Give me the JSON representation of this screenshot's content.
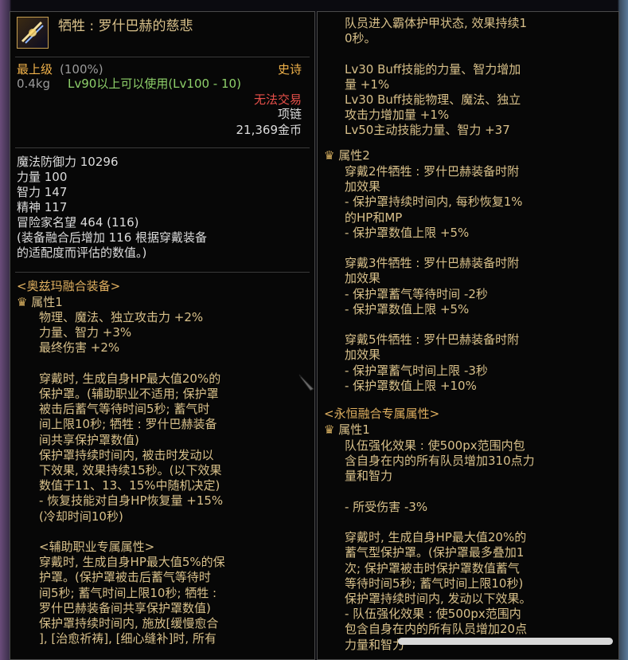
{
  "left": {
    "title": "牺牲 : 罗什巴赫的慈悲",
    "grade": "最上级",
    "grade_pct": "(100%)",
    "rarity": "史诗",
    "weight": "0.4kg",
    "level_req": "Lv90以上可以使用(Lv100 - 10)",
    "trade": "无法交易",
    "slot": "项链",
    "price": "21,369金币",
    "stats": [
      "魔法防御力 10296",
      "力量 100",
      "智力 147",
      "精神 117",
      "冒险家名望 464 (116)",
      "(装备融合后增加 116 根据穿戴装备",
      "的适配度而评估的数值。)"
    ],
    "fusion_header": "<奥兹玛融合装备>",
    "attr1_label": "属性1",
    "attr1_lines": [
      "物理、魔法、独立攻击力 +2%",
      "力量、智力 +3%",
      "最终伤害 +2%",
      "",
      "穿戴时, 生成自身HP最大值20%的",
      "保护罩。(辅助职业不适用; 保护罩",
      "被击后蓄气等待时间5秒; 蓄气时",
      "间上限10秒; 牺牲 : 罗什巴赫装备",
      "间共享保护罩数值)",
      "保护罩持续时间内, 被击时发动以",
      "下效果, 效果持续15秒。(以下效果",
      "数值于11、13、15%中随机决定)",
      "- 恢复技能对自身HP恢复量 +15%",
      "(冷却时间10秒)",
      "",
      "<辅助职业专属属性>",
      "穿戴时, 生成自身HP最大值5%的保",
      "护罩。(保护罩被击后蓄气等待时",
      "间5秒; 蓄气时间上限10秒; 牺牲 :",
      "罗什巴赫装备间共享保护罩数值)",
      "保护罩持续时间内, 施放[缓慢愈合",
      "], [治愈祈祷], [细心缝补]时, 所有"
    ]
  },
  "right": {
    "top_lines": [
      "队员进入霸体护甲状态, 效果持续1",
      "0秒。",
      "",
      "Lv30 Buff技能的力量、智力增加",
      "量 +1%",
      "Lv30 Buff技能物理、魔法、独立",
      "攻击力增加量 +1%",
      "Lv50主动技能力量、智力 +37"
    ],
    "attr2_label": "属性2",
    "attr2_lines": [
      "穿戴2件牺牲 : 罗什巴赫装备时附",
      "加效果",
      "- 保护罩持续时间内, 每秒恢复1%",
      "的HP和MP",
      "- 保护罩数值上限 +5%",
      "",
      "穿戴3件牺牲 : 罗什巴赫装备时附",
      "加效果",
      "- 保护罩蓄气等待时间 -2秒",
      "- 保护罩数值上限 +5%",
      "",
      "穿戴5件牺牲 : 罗什巴赫装备时附",
      "加效果",
      "- 保护罩蓄气时间上限 -3秒",
      "- 保护罩数值上限 +10%"
    ],
    "eternal_header": "<永恒融合专属属性>",
    "eattr1_label": "属性1",
    "eattr1_lines": [
      "队伍强化效果 : 使500px范围内包",
      "含自身在内的所有队员增加310点力",
      "量和智力",
      "",
      "- 所受伤害 -3%",
      "",
      "穿戴时, 生成自身HP最大值20%的",
      "蓄气型保护罩。(保护罩最多叠加1",
      "次; 保护罩被击时保护罩数值蓄气",
      "等待时间5秒; 蓄气时间上限10秒)",
      "保护罩持续时间内, 发动以下效果。",
      "- 队伍强化效果 : 使500px范围内",
      "包含自身在内的所有队员增加20点",
      "力量和智力"
    ]
  }
}
